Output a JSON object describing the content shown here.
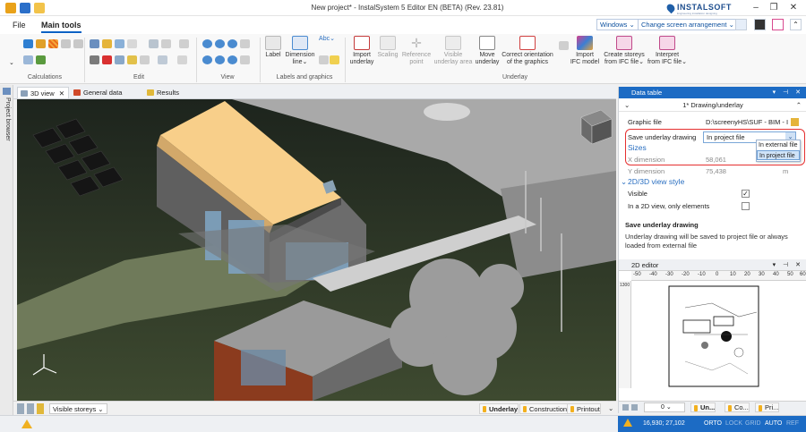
{
  "app": {
    "title": "New project* - InstalSystem 5 Editor EN (BETA) (Rev. 23.81)",
    "brand_name": "INSTALSOFT",
    "brand_tagline": "Engineering installation designing"
  },
  "window_controls": {
    "minimize": "–",
    "maximize": "❐",
    "close": "✕"
  },
  "menu": {
    "file": "File",
    "main_tools": "Main tools",
    "windows": "Windows",
    "change_arrangement": "Change screen arrangement"
  },
  "ribbon": {
    "groups": {
      "calculations": "Calculations",
      "edit": "Edit",
      "view": "View",
      "labels": "Labels and graphics",
      "underlay": "Underlay"
    },
    "labels_buttons": {
      "label": "Label",
      "dimension": "Dimension",
      "dimension_line": "line",
      "abc": "Abc"
    },
    "underlay_buttons": [
      {
        "l1": "Import",
        "l2": "underlay",
        "dim": false
      },
      {
        "l1": "Scaling",
        "l2": "",
        "dim": true
      },
      {
        "l1": "Reference",
        "l2": "point",
        "dim": true
      },
      {
        "l1": "Visible",
        "l2": "underlay area",
        "dim": true
      },
      {
        "l1": "Move",
        "l2": "underlay",
        "dim": false
      },
      {
        "l1": "Correct orientation",
        "l2": "of the graphics",
        "dim": false
      },
      {
        "l1": "Import",
        "l2": "IFC model",
        "dim": false
      },
      {
        "l1": "Create storeys",
        "l2": "from IFC file",
        "dim": false
      },
      {
        "l1": "Interpret",
        "l2": "from IFC file",
        "dim": false
      }
    ]
  },
  "left_panel": {
    "label": "Project browser"
  },
  "doc_tabs": {
    "view3d": "3D view",
    "general": "General data",
    "results": "Results"
  },
  "viewport_bottom": {
    "visible_storeys": "Visible storeys",
    "tabs": [
      "Underlay",
      "Construction",
      "Printout"
    ]
  },
  "data_table": {
    "title": "Data table",
    "subtitle": "1* Drawing/underlay",
    "graphic_file_label": "Graphic file",
    "graphic_file_value": "D:\\screenyHS\\SUF - BIM - I",
    "save_label": "Save underlay drawing",
    "save_value": "In project file",
    "dropdown_options": [
      "In external file",
      "In project file"
    ],
    "sizes_header": "Sizes",
    "x_label": "X dimension",
    "x_value": "58,061",
    "y_label": "Y dimension",
    "y_value": "75,438",
    "y_unit": "m",
    "view_header": "2D/3D view style",
    "visible_label": "Visible",
    "visible_checked": true,
    "only_elements_label": "In a 2D view, only elements",
    "only_elements_checked": false,
    "desc_title": "Save underlay drawing",
    "desc_text": "Underlay drawing will be saved to project file or always loaded from external file"
  },
  "editor_2d": {
    "title": "2D editor",
    "ruler_ticks": [
      "-50",
      "-40",
      "-30",
      "-20",
      "-10",
      "0",
      "10",
      "20",
      "30",
      "40",
      "50",
      "60"
    ],
    "ruler_v_label": "1300",
    "storey_value": "0",
    "bottom_tabs": [
      "Un...",
      "Co...",
      "Pri..."
    ]
  },
  "status": {
    "coords": "16,930; 27,102",
    "flags": [
      "ORTO",
      "LOCK",
      "GRID",
      "AUTO",
      "REF"
    ]
  }
}
